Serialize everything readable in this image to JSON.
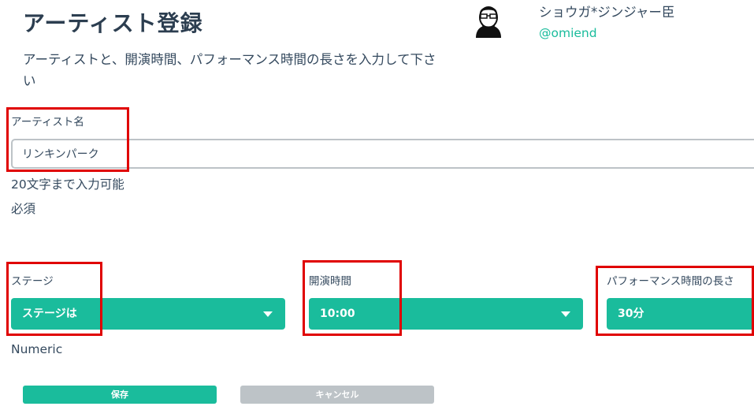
{
  "header": {
    "title": "アーティスト登録",
    "description": "アーティストと、開演時間、パフォーマンス時間の長さを入力して下さい"
  },
  "user": {
    "name": "ショウガ*ジンジャー臣",
    "handle": "@omiend",
    "avatar_icon": "user-avatar-photo"
  },
  "form": {
    "artist": {
      "label": "アーティスト名",
      "value": "リンキンパーク",
      "hint_length": "20文字まで入力可能",
      "hint_required": "必須"
    },
    "stage": {
      "label": "ステージ",
      "selected": "ステージは",
      "hint": "Numeric"
    },
    "start_time": {
      "label": "開演時間",
      "selected": "10:00"
    },
    "duration": {
      "label": "パフォーマンス時間の長さ",
      "selected": "30分"
    },
    "save_label": "保存",
    "cancel_label": "キャンセル"
  },
  "colors": {
    "accent": "#1abc9c",
    "text": "#34495e",
    "cancel": "#bdc3c7",
    "highlight": "#e00000"
  }
}
